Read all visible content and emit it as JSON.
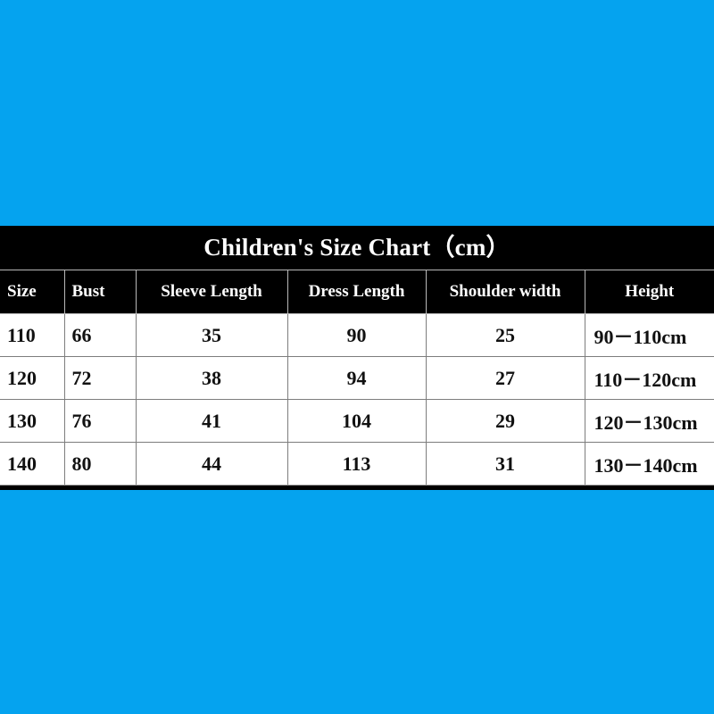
{
  "background": {
    "color": "#05a3ef"
  },
  "chart": {
    "title_main": "Children's Size Chart",
    "title_unit": "（cm）",
    "header_bg": "#000000",
    "header_fg": "#ffffff",
    "body_bg": "#ffffff",
    "body_fg": "#111111"
  },
  "chart_data": {
    "type": "table",
    "title": "Children's Size Chart（cm）",
    "columns": [
      "Size",
      "Bust",
      "Sleeve Length",
      "Dress Length",
      "Shoulder width",
      "Height"
    ],
    "rows": [
      [
        "110",
        "66",
        "35",
        "90",
        "25",
        "90－110cm"
      ],
      [
        "120",
        "72",
        "38",
        "94",
        "27",
        "110－120cm"
      ],
      [
        "130",
        "76",
        "41",
        "104",
        "29",
        "120－130cm"
      ],
      [
        "140",
        "80",
        "44",
        "113",
        "31",
        "130－140cm"
      ]
    ],
    "units": "cm",
    "xlabel": "",
    "ylabel": ""
  }
}
